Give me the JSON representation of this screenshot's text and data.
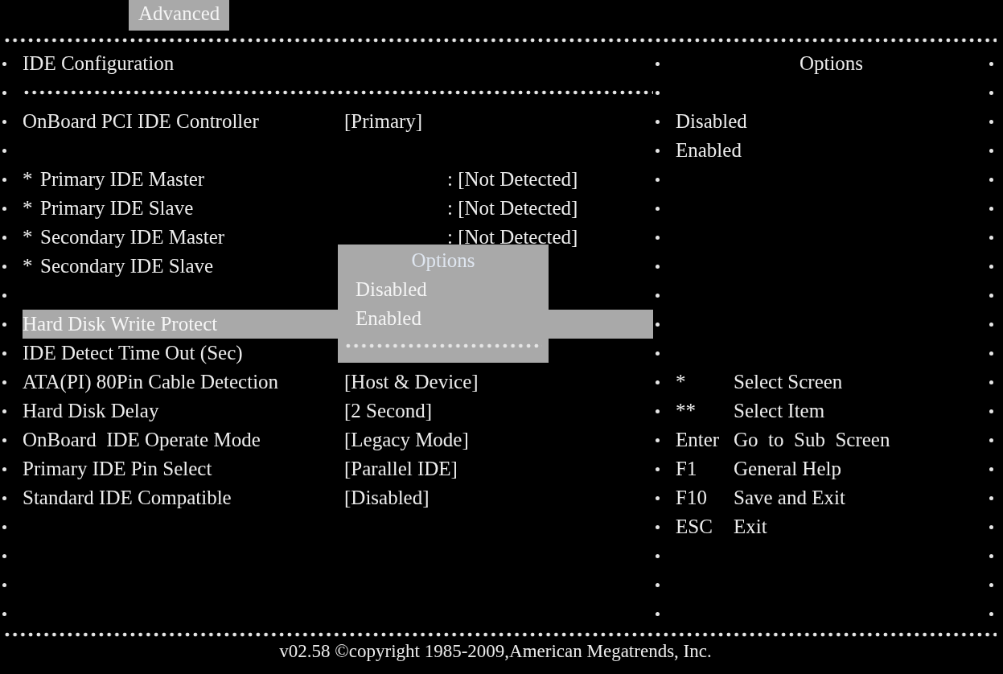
{
  "tabs": [
    {
      "label": "Advanced",
      "selected": true
    }
  ],
  "rows": [
    {
      "kind": "header",
      "label": "IDE Configuration"
    },
    {
      "kind": "separator"
    },
    {
      "kind": "setting",
      "label": "OnBoard PCI IDE Controller",
      "value": "[Primary]",
      "selected": false
    },
    {
      "kind": "blank"
    },
    {
      "kind": "submenu",
      "marker": "*",
      "label": "Primary IDE Master",
      "value": ": [Not Detected]",
      "selected": false
    },
    {
      "kind": "submenu",
      "marker": "*",
      "label": "Primary IDE Slave",
      "value": ": [Not Detected]",
      "selected": false
    },
    {
      "kind": "submenu",
      "marker": "*",
      "label": "Secondary IDE Master",
      "value": ": [Not Detected]",
      "selected": false
    },
    {
      "kind": "submenu",
      "marker": "*",
      "label": "Secondary IDE Slave",
      "selected": false
    },
    {
      "kind": "blank"
    },
    {
      "kind": "setting",
      "label": "Hard Disk Write Protect",
      "selected": true
    },
    {
      "kind": "setting",
      "label": "IDE Detect Time Out (Sec)",
      "selected": false
    },
    {
      "kind": "setting",
      "label": "ATA(PI) 80Pin Cable Detection",
      "value": "[Host & Device]",
      "selected": false
    },
    {
      "kind": "setting",
      "label": "Hard Disk Delay",
      "value": "[2 Second]",
      "selected": false
    },
    {
      "kind": "setting",
      "label": "OnBoard  IDE Operate Mode",
      "value": "[Legacy Mode]",
      "selected": false
    },
    {
      "kind": "setting",
      "label": "Primary IDE Pin Select",
      "value": "[Parallel IDE]",
      "selected": false
    },
    {
      "kind": "setting",
      "label": "Standard IDE Compatible",
      "value": "[Disabled]",
      "selected": false
    }
  ],
  "popup": {
    "title": "Options",
    "items": [
      "Disabled",
      "Enabled"
    ]
  },
  "help_panel": {
    "title": "Options",
    "options": [
      "Disabled",
      "Enabled"
    ],
    "keys": [
      {
        "key": "*",
        "action": "Select Screen"
      },
      {
        "key": "**",
        "action": "Select Item"
      },
      {
        "key": "Enter",
        "action": "Go  to  Sub  Screen"
      },
      {
        "key": "F1",
        "action": "General Help"
      },
      {
        "key": "F10",
        "action": "Save and Exit"
      },
      {
        "key": "ESC",
        "action": "Exit"
      }
    ]
  },
  "footer": "v02.58 ©copyright  1985-2009,American Megatrends, Inc."
}
